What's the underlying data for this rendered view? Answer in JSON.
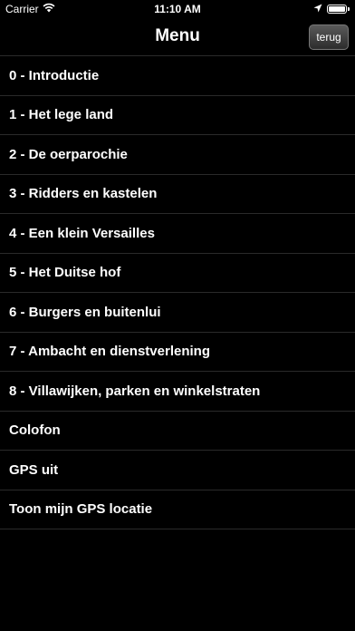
{
  "status_bar": {
    "carrier": "Carrier",
    "time": "11:10 AM",
    "icons": [
      "wifi-icon",
      "location-arrow-icon",
      "battery-icon"
    ],
    "battery_level": 1.0
  },
  "nav_bar": {
    "title": "Menu",
    "back_label": "terug"
  },
  "menu": {
    "items": [
      {
        "label": "0 - Introductie"
      },
      {
        "label": "1 - Het lege land"
      },
      {
        "label": "2 - De oerparochie"
      },
      {
        "label": "3 - Ridders en kastelen"
      },
      {
        "label": "4 - Een klein Versailles"
      },
      {
        "label": "5 - Het Duitse hof"
      },
      {
        "label": "6 - Burgers en buitenlui"
      },
      {
        "label": "7 - Ambacht en dienstverlening"
      },
      {
        "label": "8 - Villawijken, parken en winkelstraten"
      },
      {
        "label": "Colofon"
      },
      {
        "label": "GPS uit"
      },
      {
        "label": "Toon mijn GPS locatie"
      }
    ]
  },
  "colors": {
    "background": "#000000",
    "text": "#ffffff",
    "separator": "#2a2a2a"
  }
}
